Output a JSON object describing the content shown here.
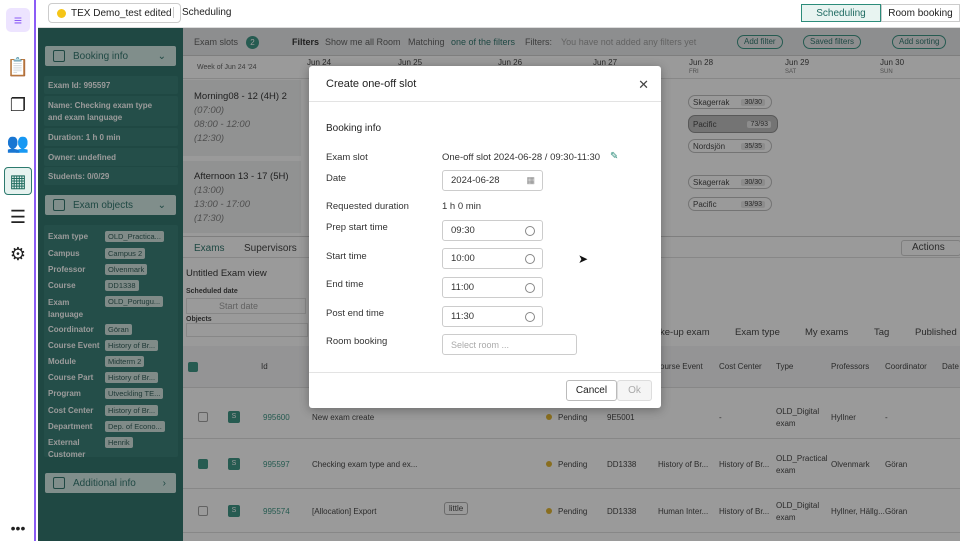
{
  "app": {
    "project": "TEX Demo_test edited",
    "crumb": "Scheduling",
    "toggle": [
      "Scheduling",
      "Room booking"
    ]
  },
  "colors": {
    "accent": "#1f6b62",
    "purple": "#8b5cf6"
  },
  "sidebar": {
    "booking_info": "Booking info",
    "exam_id": "Exam Id: 995597",
    "name": "Name: Checking exam type and exam language",
    "duration": "Duration: 1 h 0 min",
    "owner": "Owner: undefined",
    "students": "Students: 0/0/29",
    "exam_objects": "Exam objects",
    "objects": [
      {
        "k": "Exam type",
        "v": "OLD_Practica..."
      },
      {
        "k": "Campus",
        "v": "Campus 2"
      },
      {
        "k": "Professor",
        "v": "Olvenmark"
      },
      {
        "k": "Course",
        "v": "DD1338"
      },
      {
        "k": "Exam language",
        "v": "OLD_Portugu..."
      },
      {
        "k": "Coordinator",
        "v": "Göran"
      },
      {
        "k": "Course Event",
        "v": "History of Br..."
      },
      {
        "k": "Module",
        "v": "Midterm 2"
      },
      {
        "k": "Course Part",
        "v": "History of Br..."
      },
      {
        "k": "Program",
        "v": "Utveckling TE..."
      },
      {
        "k": "Cost Center",
        "v": "History of Br..."
      },
      {
        "k": "Department",
        "v": "Dep. of Econo..."
      },
      {
        "k": "External Customer",
        "v": "Henrik"
      }
    ],
    "additional": "Additional info"
  },
  "grid": {
    "exam_slots": "Exam slots",
    "slot_count": "2",
    "filters": "Filters",
    "show_all": "Show me all Room",
    "matching": "Matching",
    "one_of": "one of the filters",
    "filters2": "Filters:",
    "none": "You have not added any filters yet",
    "add_filter": "Add filter",
    "saved_filters": "Saved filters",
    "add_sorting": "Add sorting",
    "week": "Week of Jun 24 '24",
    "days": [
      {
        "d": "Jun 24",
        "w": ""
      },
      {
        "d": "Jun 25",
        "w": ""
      },
      {
        "d": "Jun 26",
        "w": ""
      },
      {
        "d": "Jun 27",
        "w": ""
      },
      {
        "d": "Jun 28",
        "w": "FRI"
      },
      {
        "d": "Jun 29",
        "w": "SAT"
      },
      {
        "d": "Jun 30",
        "w": "SUN"
      }
    ],
    "slot1": {
      "title": "Morning08 - 12 (4H) 2",
      "a": "(07:00)",
      "b": "08:00 - 12:00",
      "c": "(12:30)"
    },
    "slot2": {
      "title": "Afternoon 13 - 17 (5H)",
      "a": "(13:00)",
      "b": "13:00 - 17:00",
      "c": "(17:30)"
    },
    "rooms1": [
      {
        "n": "Skagerrak",
        "c": "30/30"
      },
      {
        "n": "Pacific",
        "c": "73/93"
      },
      {
        "n": "Nordsjön",
        "c": "35/35"
      }
    ],
    "rooms2": [
      {
        "n": "Skagerrak",
        "c": "30/30"
      },
      {
        "n": "Pacific",
        "c": "93/93"
      }
    ]
  },
  "table": {
    "tabs": [
      "Exams",
      "Supervisors"
    ],
    "actions": "Actions",
    "view": "Untitled Exam view",
    "sched": "Scheduled date",
    "start": "Start date",
    "objects": "Objects",
    "colfilters": [
      "ke-up exam",
      "Exam type",
      "My exams",
      "Tag",
      "Published"
    ],
    "headers": [
      "Id",
      "ourse Event",
      "Cost Center",
      "Type",
      "Professors",
      "Coordinator",
      "Date"
    ],
    "rows": [
      {
        "id": "995600",
        "name": "New exam create",
        "status": "Pending",
        "course": "9E5001",
        "event": "",
        "cost": "-",
        "type": "OLD_Digital exam",
        "prof": "Hyllner",
        "coord": "-"
      },
      {
        "id": "995597",
        "name": "Checking exam type and ex...",
        "status": "Pending",
        "course": "DD1338",
        "event": "History of Br...",
        "cost": "History of Br...",
        "type": "OLD_Practical exam",
        "prof": "Olvenmark",
        "coord": "Göran"
      },
      {
        "id": "995574",
        "name": "[Allocation] Export",
        "tag": "little",
        "status": "Pending",
        "course": "DD1338",
        "event": "Human Inter...",
        "cost": "History of Br...",
        "type": "OLD_Digital exam",
        "prof": "Hyllner, Hällg...",
        "coord": "Göran"
      }
    ]
  },
  "modal": {
    "title": "Create one-off slot",
    "section": "Booking info",
    "exam_slot_label": "Exam slot",
    "exam_slot_value": "One-off slot 2024-06-28 / 09:30-11:30",
    "date_label": "Date",
    "date_value": "2024-06-28",
    "req_label": "Requested duration",
    "req_value": "1 h 0 min",
    "prep_label": "Prep start time",
    "prep_value": "09:30",
    "start_label": "Start time",
    "start_value": "10:00",
    "end_label": "End time",
    "end_value": "11:00",
    "post_label": "Post end time",
    "post_value": "11:30",
    "room_label": "Room booking",
    "room_placeholder": "Select room ...",
    "cancel": "Cancel",
    "ok": "Ok"
  }
}
